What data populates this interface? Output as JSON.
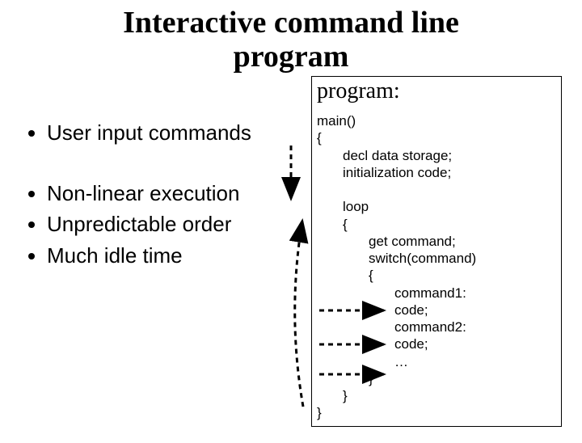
{
  "title_line1": "Interactive command line",
  "title_line2": "program",
  "bullets": {
    "b1": "User input commands",
    "b2": "Non-linear execution",
    "b3": "Unpredictable order",
    "b4": "Much idle time"
  },
  "code": {
    "heading": "program:",
    "l_main": "main()",
    "l_open": "{",
    "l_decl": "decl data storage;",
    "l_init": "initialization code;",
    "l_loop": "loop",
    "l_loop_open": "{",
    "l_get": "get command;",
    "l_switch": "switch(command)",
    "l_switch_open": "{",
    "l_cmd1": "command1:",
    "l_code1": "code;",
    "l_cmd2": "command2:",
    "l_code2": "code;",
    "l_dots": "…",
    "l_switch_close": "}",
    "l_loop_close": "}",
    "l_main_close": "}"
  }
}
